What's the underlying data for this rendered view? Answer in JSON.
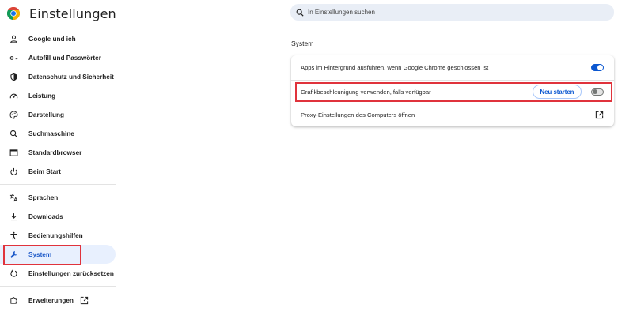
{
  "header": {
    "title": "Einstellungen",
    "logo_icon": "chrome-logo-icon"
  },
  "search": {
    "placeholder": "In Einstellungen suchen",
    "value": ""
  },
  "sidebar": {
    "items": [
      {
        "label": "Google und ich",
        "icon": "person-icon"
      },
      {
        "label": "Autofill und Passwörter",
        "icon": "key-icon"
      },
      {
        "label": "Datenschutz und Sicherheit",
        "icon": "shield-icon"
      },
      {
        "label": "Leistung",
        "icon": "speedometer-icon"
      },
      {
        "label": "Darstellung",
        "icon": "palette-icon"
      },
      {
        "label": "Suchmaschine",
        "icon": "search-icon"
      },
      {
        "label": "Standardbrowser",
        "icon": "browser-window-icon"
      },
      {
        "label": "Beim Start",
        "icon": "power-icon"
      },
      {
        "label": "Sprachen",
        "icon": "translate-icon"
      },
      {
        "label": "Downloads",
        "icon": "download-icon"
      },
      {
        "label": "Bedienungshilfen",
        "icon": "accessibility-icon"
      },
      {
        "label": "System",
        "icon": "wrench-icon",
        "selected": true
      },
      {
        "label": "Einstellungen zurücksetzen",
        "icon": "reset-icon"
      },
      {
        "label": "Erweiterungen",
        "icon": "puzzle-icon"
      }
    ]
  },
  "main": {
    "section_title": "System",
    "rows": [
      {
        "label": "Apps im Hintergrund ausführen, wenn Google Chrome geschlossen ist",
        "toggle": true
      },
      {
        "label": "Grafikbeschleunigung verwenden, falls verfügbar",
        "toggle": false,
        "button_label": "Neu starten"
      },
      {
        "label": "Proxy-Einstellungen des Computers öffnen",
        "icon": "open-in-new-icon"
      }
    ]
  },
  "colors": {
    "accent": "#0b57d0",
    "selected_bg": "#e8f0fe",
    "highlight": "#e0333c"
  }
}
